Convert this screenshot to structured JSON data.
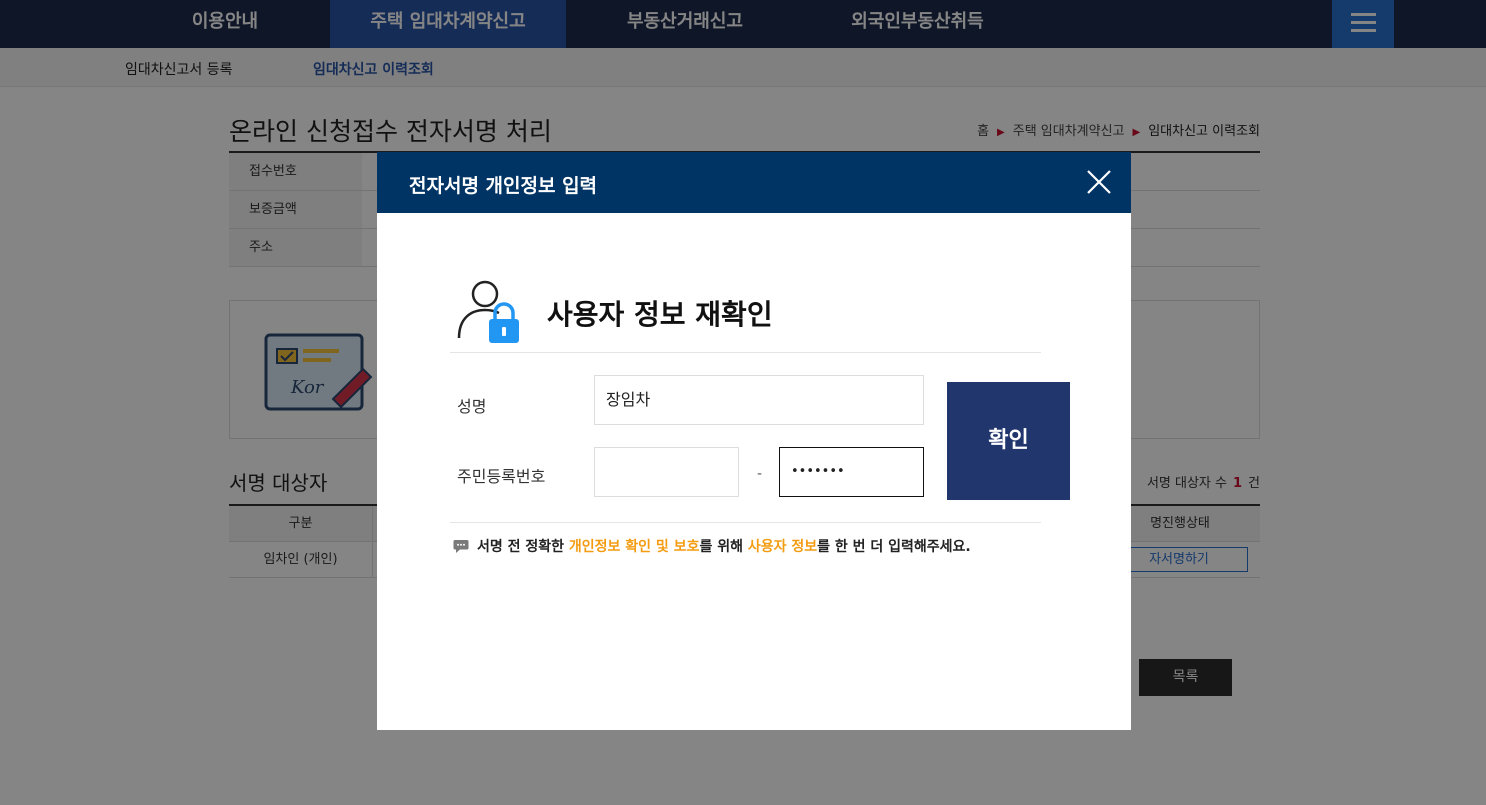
{
  "topnav": {
    "items": [
      "이용안내",
      "주택 임대차계약신고",
      "부동산거래신고",
      "외국인부동산취득"
    ],
    "active_index": 1
  },
  "subnav": {
    "items": [
      "임대차신고서 등록",
      "임대차신고 이력조회"
    ],
    "active_index": 1
  },
  "page": {
    "title": "온라인 신청접수 전자서명 처리",
    "breadcrumb": [
      "홈",
      "주택 임대차계약신고",
      "임대차신고 이력조회"
    ]
  },
  "info_table": {
    "rows": [
      "접수번호",
      "보증금액",
      "주소"
    ]
  },
  "sign_target": {
    "title": "서명 대상자",
    "count_label": "서명 대상자 수",
    "count": "1",
    "count_unit": "건",
    "col_type": "구분",
    "col_status": "명진행상태",
    "row_type": "임차인 (개인)",
    "row_action": "자서명하기"
  },
  "list_button": "목록",
  "modal": {
    "title": "전자서명 개인정보 입력",
    "subtitle": "사용자 정보 재확인",
    "name_label": "성명",
    "name_value": "장임차",
    "rrn_label": "주민등록번호",
    "rrn_front_value": "",
    "rrn_dash": "-",
    "rrn_back_value": "•••••••",
    "confirm_label": "확인",
    "notice": {
      "part1": "서명 전 정확한 ",
      "hl1": "개인정보 확인 및 보호",
      "part2": "를 위해 ",
      "hl2": "사용자 정보",
      "part3": "를 한 번 더 입력해주세요."
    }
  },
  "colors": {
    "nav_bg": "#1c2b4e",
    "nav_active": "#2a55a8",
    "modal_header": "#003465",
    "confirm_btn": "#22366e",
    "highlight": "#f39c12",
    "lock_blue": "#2196f3"
  }
}
